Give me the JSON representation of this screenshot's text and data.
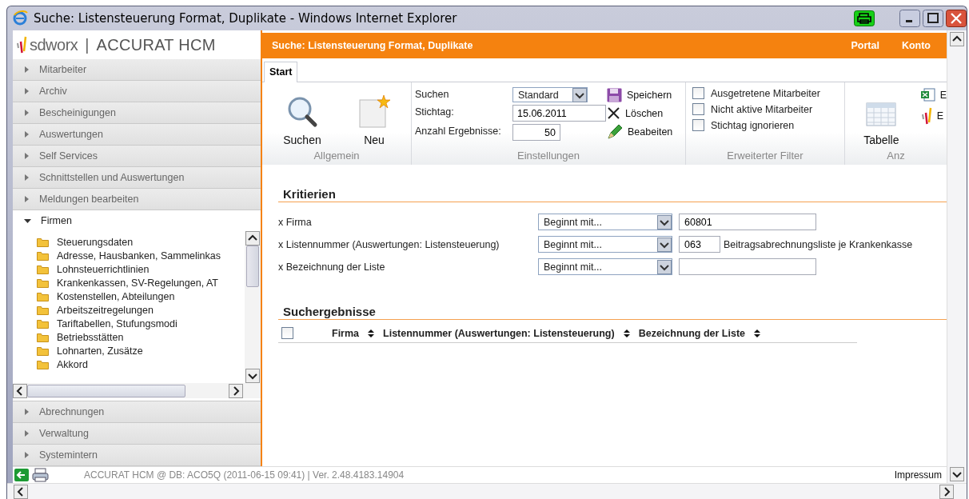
{
  "window": {
    "title": "Suche: Listensteuerung Format, Duplikate - Windows Internet Explorer"
  },
  "sidebar": {
    "brand": "sdworx",
    "separator": "|",
    "product": "ACCURAT HCM",
    "sections": [
      {
        "label": "Mitarbeiter",
        "expanded": false
      },
      {
        "label": "Archiv",
        "expanded": false
      },
      {
        "label": "Bescheinigungen",
        "expanded": false
      },
      {
        "label": "Auswertungen",
        "expanded": false
      },
      {
        "label": "Self Services",
        "expanded": false
      },
      {
        "label": "Schnittstellen und Auswertungen",
        "expanded": false
      },
      {
        "label": "Meldungen bearbeiten",
        "expanded": false
      },
      {
        "label": "Firmen",
        "expanded": true,
        "children": [
          {
            "label": "Steuerungsdaten"
          },
          {
            "label": "Adresse, Hausbanken, Sammelinkas"
          },
          {
            "label": "Lohnsteuerrichtlinien"
          },
          {
            "label": "Krankenkassen, SV-Regelungen, AT"
          },
          {
            "label": "Kostenstellen, Abteilungen"
          },
          {
            "label": "Arbeitszeitregelungen"
          },
          {
            "label": "Tariftabellen, Stufungsmodi"
          },
          {
            "label": "Betriebsstätten"
          },
          {
            "label": "Lohnarten, Zusätze"
          },
          {
            "label": "Akkord"
          }
        ]
      },
      {
        "label": "Abrechnungen",
        "expanded": false
      },
      {
        "label": "Verwaltung",
        "expanded": false
      },
      {
        "label": "Systemintern",
        "expanded": false
      }
    ]
  },
  "header": {
    "title": "Suche: Listensteuerung Format, Duplikate",
    "links": [
      "Portal",
      "Konto"
    ]
  },
  "tabs": [
    {
      "label": "Start",
      "selected": true
    }
  ],
  "ribbon": [
    {
      "kind": "large",
      "label": "Allgemein",
      "buttons": [
        "Suchen",
        "Neu"
      ]
    },
    {
      "kind": "settings",
      "label": "Einstellungen",
      "fields": [
        {
          "kind": "select",
          "label": "Suchen",
          "value": "Standard"
        },
        {
          "kind": "text",
          "label": "Stichtag:",
          "value": "15.06.2011"
        },
        {
          "kind": "number",
          "label": "Anzahl Ergebnisse:",
          "value": "50"
        }
      ],
      "actions": [
        "Speichern",
        "Löschen",
        "Beabeiten"
      ]
    },
    {
      "kind": "checks",
      "label": "Erweiterter Filter",
      "options": [
        {
          "label": "Ausgetretene Mitarbeiter",
          "checked": false
        },
        {
          "label": "Nicht aktive Mitarbeiter",
          "checked": false
        },
        {
          "label": "Stichtag ignorieren",
          "checked": false
        }
      ]
    },
    {
      "kind": "view",
      "label": "Anz",
      "buttons": [
        "Tabelle"
      ],
      "links": [
        "E",
        "E"
      ]
    }
  ],
  "criteria": {
    "title": "Kritierien",
    "rows": [
      {
        "label": "x Firma",
        "operator": "Beginnt mit...",
        "value": "60801"
      },
      {
        "label": "x Listennummer (Auswertungen: Listensteuerung)",
        "operator": "Beginnt mit...",
        "value": "063",
        "description": "Beitragsabrechnungsliste je Krankenkasse"
      },
      {
        "label": "x Bezeichnung der Liste",
        "operator": "Beginnt mit..."
      }
    ]
  },
  "results": {
    "title": "Suchergebnisse",
    "select_all": {
      "checked": false
    },
    "columns": [
      "Firma",
      "Listennummer (Auswertungen: Listensteuerung)",
      "Bezeichnung der Liste"
    ]
  },
  "status_bar": {
    "text": "ACCURAT HCM @ DB: ACO5Q (2011-06-15 09:41) | Ver. 2.48.4183.14904",
    "link": "Impressum"
  }
}
